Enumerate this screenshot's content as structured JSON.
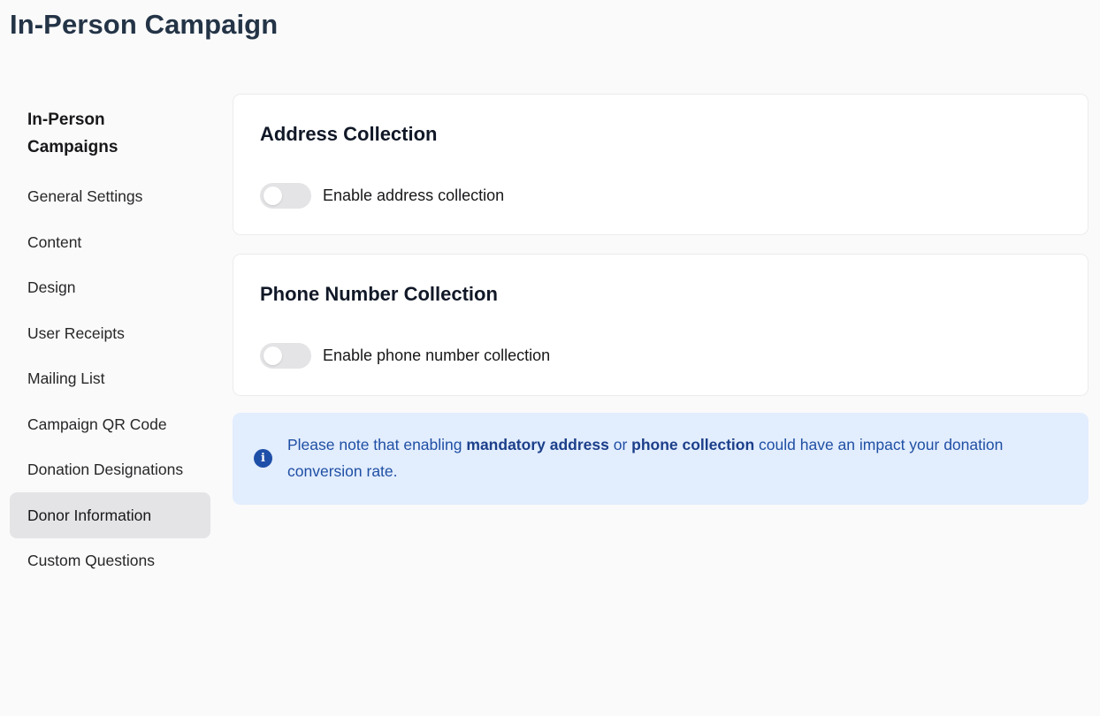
{
  "page": {
    "title": "In-Person Campaign"
  },
  "sidebar": {
    "heading_line1": "In-Person",
    "heading_line2": "Campaigns",
    "items": [
      {
        "label": "General Settings",
        "active": false
      },
      {
        "label": "Content",
        "active": false
      },
      {
        "label": "Design",
        "active": false
      },
      {
        "label": "User Receipts",
        "active": false
      },
      {
        "label": "Mailing List",
        "active": false
      },
      {
        "label": "Campaign QR Code",
        "active": false
      },
      {
        "label": "Donation Designations",
        "active": false
      },
      {
        "label": "Donor Information",
        "active": true
      },
      {
        "label": "Custom Questions",
        "active": false
      }
    ]
  },
  "address_card": {
    "title": "Address Collection",
    "toggle_label": "Enable address collection",
    "enabled": false
  },
  "phone_card": {
    "title": "Phone Number Collection",
    "toggle_label": "Enable phone number collection",
    "enabled": false
  },
  "notice": {
    "icon": "info-icon",
    "text_before": "Please note that enabling ",
    "bold_1": "mandatory address",
    "text_middle": " or ",
    "bold_2": "phone collection",
    "text_after": " could have an impact your donation conversion rate."
  },
  "colors": {
    "title": "#243447",
    "active_nav_bg": "#e4e4e7",
    "toggle_off": "#e4e4e7",
    "notice_bg": "#e2edfe",
    "notice_text": "#1f4fa3",
    "info_icon": "#1e4fa8"
  }
}
